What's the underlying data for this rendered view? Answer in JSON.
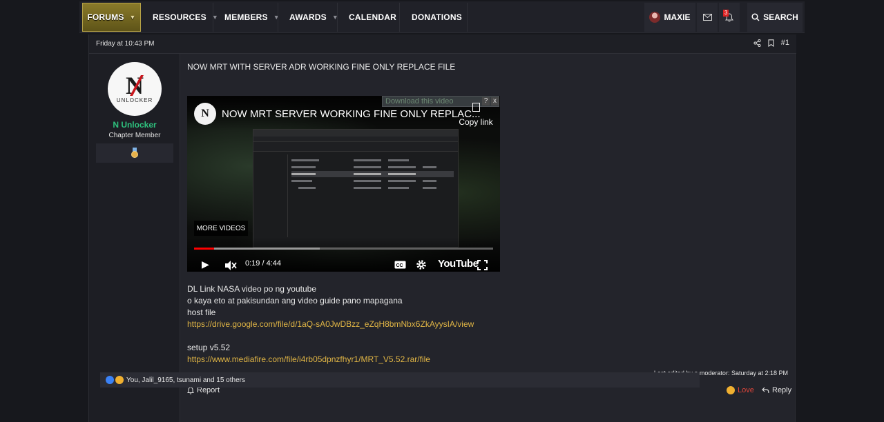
{
  "nav": {
    "items": [
      {
        "label": "FORUMS",
        "dropdown": true
      },
      {
        "label": "RESOURCES",
        "dropdown": true
      },
      {
        "label": "MEMBERS",
        "dropdown": true
      },
      {
        "label": "AWARDS",
        "dropdown": true
      },
      {
        "label": "CALENDAR",
        "dropdown": false
      },
      {
        "label": "DONATIONS",
        "dropdown": false
      }
    ],
    "user": "MAXIE",
    "alert_count": "3",
    "search_label": "SEARCH"
  },
  "post": {
    "date": "Friday at 10:43 PM",
    "number": "#1",
    "author": {
      "name": "N Unlocker",
      "title": "Chapter Member",
      "avatar_text": "N",
      "avatar_subtext": "UNLOCKER"
    },
    "headline": "NOW MRT WITH SERVER ADR WORKING FINE ONLY REPLACE FILE",
    "video": {
      "title": "NOW MRT SERVER WORKING FINE ONLY REPLAC...",
      "download_label": "Download this video",
      "copy_link": "Copy link",
      "more_videos": "MORE VIDEOS",
      "time": "0:19 / 4:44",
      "brand": "YouTube",
      "played_fraction": 0.067,
      "buffered_fraction": 0.42
    },
    "lines": [
      "DL Link NASA video po ng youtube",
      "o kaya eto at pakisundan ang video guide pano mapagana",
      "host file"
    ],
    "link1": "https://drive.google.com/file/d/1aQ-sA0JwDBzz_eZqH8bmNbx6ZkAyysIA/view",
    "setup_label": "setup v5.52",
    "link2": "https://www.mediafire.com/file/i4rb05dpnzfhyr1/MRT_V5.52.rar/file",
    "edited": "Last edited by a moderator: Saturday at 2:18 PM",
    "report": "Report",
    "love": "Love",
    "reply": "Reply",
    "reactions": "You, Jalil_9165, tsunami and 15 others"
  },
  "colors": {
    "accent_gold": "#e0b545",
    "username_green": "#2ec27e",
    "love_red": "#e0453a"
  }
}
